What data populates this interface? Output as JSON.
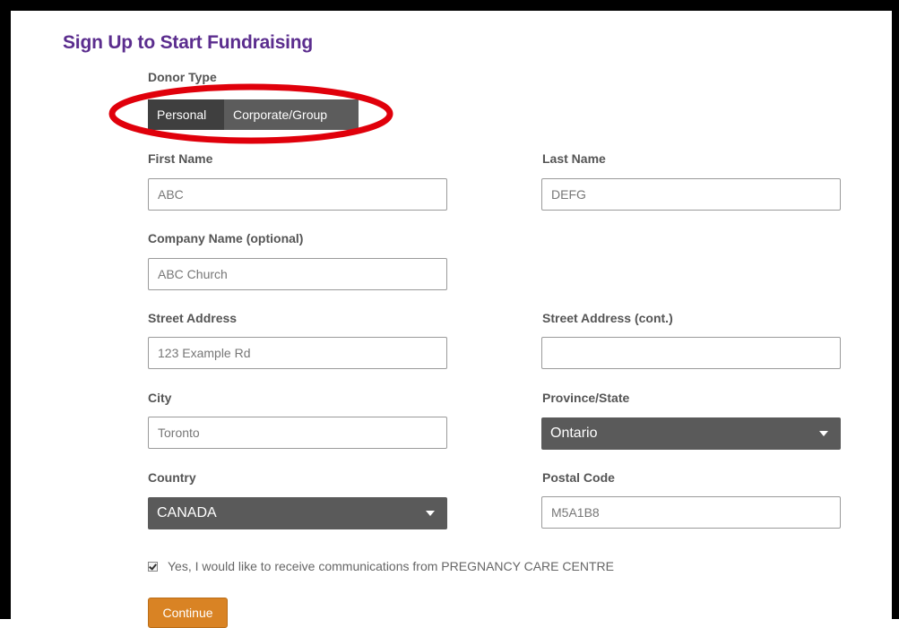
{
  "page": {
    "title": "Sign Up to Start Fundraising"
  },
  "donor_type": {
    "label": "Donor Type",
    "options": [
      "Personal",
      "Corporate/Group"
    ]
  },
  "form": {
    "first_name": {
      "label": "First Name",
      "value": "ABC"
    },
    "last_name": {
      "label": "Last Name",
      "value": "DEFG"
    },
    "company_name": {
      "label": "Company Name (optional)",
      "value": "ABC Church"
    },
    "street_address": {
      "label": "Street Address",
      "value": "123 Example Rd"
    },
    "street_address_cont": {
      "label": "Street Address (cont.)",
      "value": ""
    },
    "city": {
      "label": "City",
      "value": "Toronto"
    },
    "province_state": {
      "label": "Province/State",
      "value": "Ontario"
    },
    "country": {
      "label": "Country",
      "value": "CANADA"
    },
    "postal_code": {
      "label": "Postal Code",
      "value": "M5A1B8"
    }
  },
  "consent": {
    "checked": true,
    "label": "Yes, I would like to receive communications from PREGNANCY CARE CENTRE"
  },
  "actions": {
    "continue_label": "Continue"
  },
  "colors": {
    "title": "#5b2d8e",
    "select_bg": "#5a5a5a",
    "continue_bg": "#d98324",
    "annotation": "#e0000b"
  }
}
